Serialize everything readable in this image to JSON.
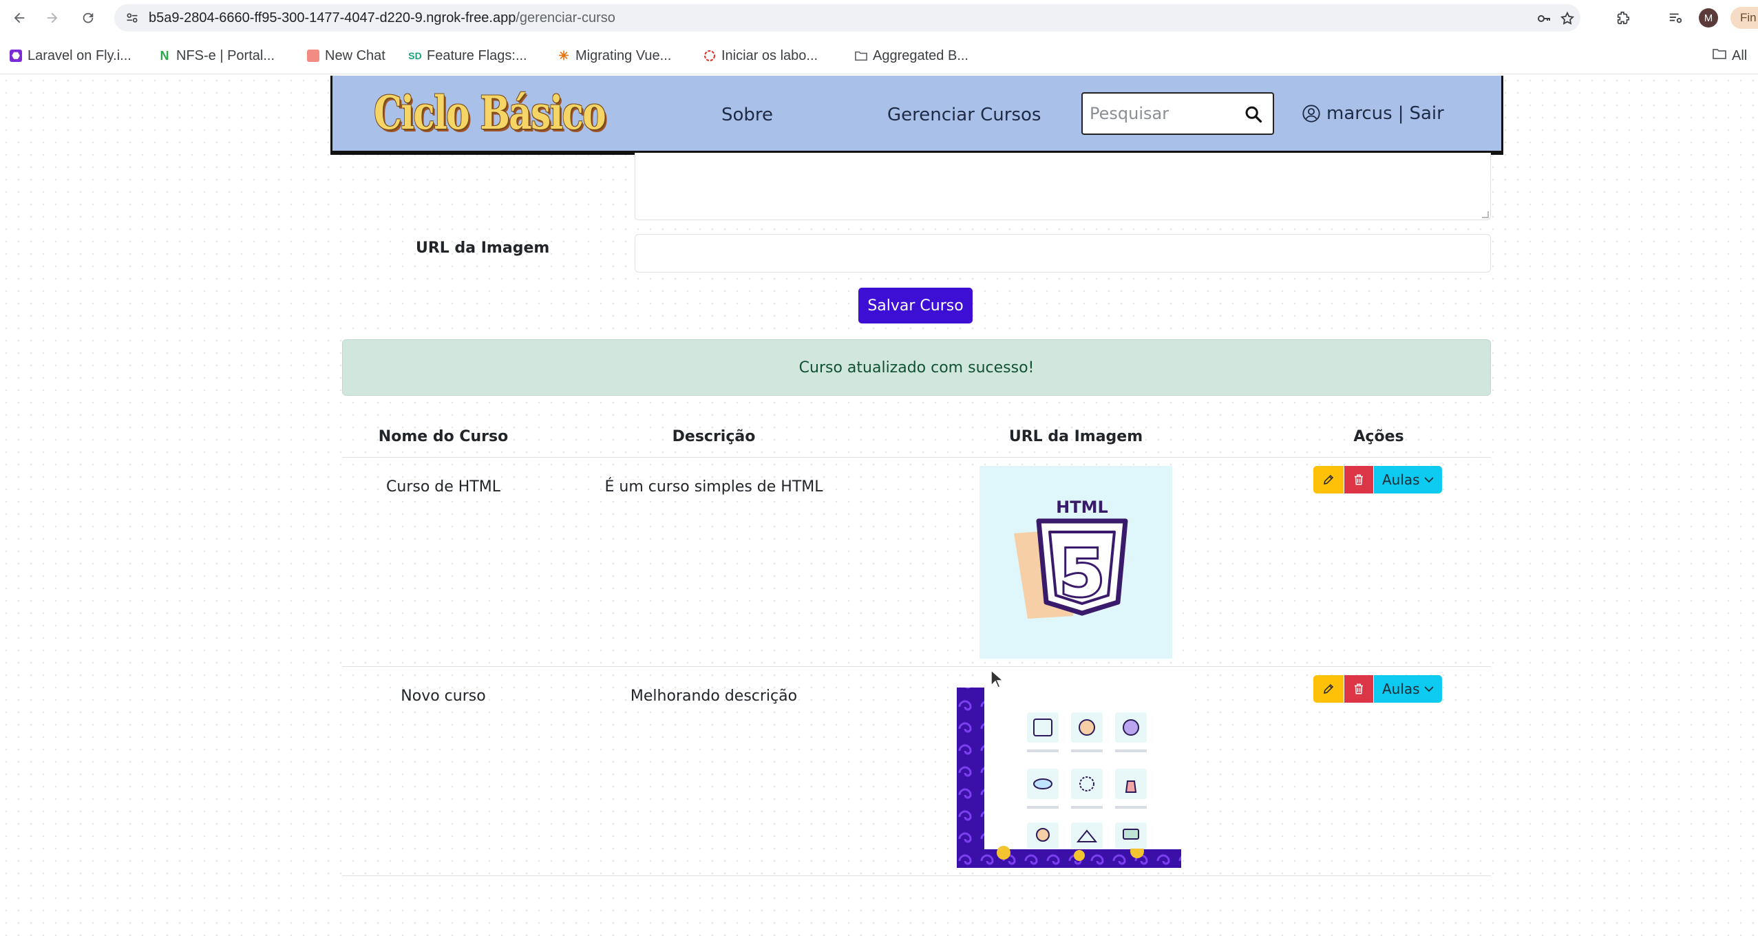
{
  "browser": {
    "url_domain": "b5a9-2804-6660-ff95-300-1477-4047-d220-9.ngrok-free.app",
    "url_path": "/gerenciar-curso",
    "profile_initial": "M",
    "find_label": "Fin",
    "bookmarks": [
      {
        "label": "Laravel on Fly.i...",
        "icon_color": "#7b2bd6"
      },
      {
        "label": "NFS-e | Portal...",
        "icon_color": "#2aa84a"
      },
      {
        "label": "New Chat",
        "icon_color": "#f28b82"
      },
      {
        "label": "Feature Flags:...",
        "icon_color": "#1aa37a"
      },
      {
        "label": "Migrating Vue...",
        "icon_color": "#e8710a"
      },
      {
        "label": "Iniciar os labo...",
        "icon_color": "#d93025"
      },
      {
        "label": "Aggregated B...",
        "icon_color": "#5f6368"
      }
    ],
    "all_bookmarks_label": "All"
  },
  "navbar": {
    "brand": "Ciclo Básico",
    "links": [
      "Sobre",
      "Gerenciar Cursos"
    ],
    "search_placeholder": "Pesquisar",
    "username": "marcus",
    "separator": "|",
    "logout": "Sair"
  },
  "form": {
    "image_url_label": "URL da Imagem",
    "image_url_value": "",
    "save_button": "Salvar Curso"
  },
  "alert": {
    "message": "Curso atualizado com sucesso!"
  },
  "table": {
    "headers": [
      "Nome do Curso",
      "Descrição",
      "URL da Imagem",
      "Ações"
    ],
    "rows": [
      {
        "name": "Curso de HTML",
        "description": "É um curso simples de HTML",
        "image_label": "HTML",
        "image_digit": "5",
        "aulas_label": "Aulas"
      },
      {
        "name": "Novo curso",
        "description": "Melhorando descrição",
        "aulas_label": "Aulas"
      }
    ]
  },
  "colors": {
    "navbar_bg": "#a9c1e8",
    "primary_button": "#3d0ed4",
    "alert_bg": "#d1e7dd",
    "edit_button": "#ffc107",
    "delete_button": "#dc3545",
    "aulas_button": "#0dcaf0"
  }
}
